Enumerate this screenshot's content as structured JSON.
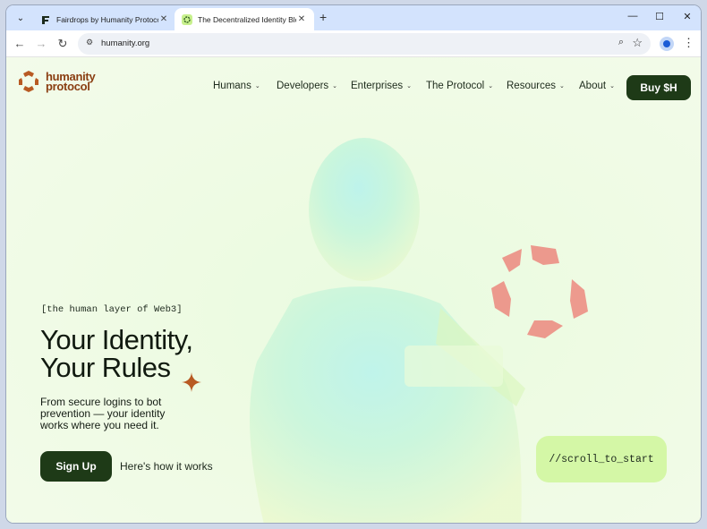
{
  "browser": {
    "tabs": [
      {
        "title": "Fairdrops by Humanity Protocol",
        "active": false
      },
      {
        "title": "The Decentralized Identity Blockchain",
        "active": true
      }
    ],
    "url": "humanity.org"
  },
  "site": {
    "logo": {
      "line1": "humanity",
      "line2": "protocol"
    },
    "nav": [
      {
        "label": "Humans"
      },
      {
        "label": "Developers"
      },
      {
        "label": "Enterprises"
      },
      {
        "label": "The Protocol"
      },
      {
        "label": "Resources"
      },
      {
        "label": "About"
      }
    ],
    "buy_label": "Buy $H",
    "brand_color": "#1e3a17",
    "accent_color": "#b85a23"
  },
  "hero": {
    "tagline": "[the human layer of Web3]",
    "headline_line1": "Your Identity,",
    "headline_line2": "Your Rules",
    "subtitle": "From secure logins to bot prevention — your identity works where you need it.",
    "signup_label": "Sign Up",
    "how_label": "Here's how it works",
    "scroll_label": "//scroll_to_start"
  }
}
